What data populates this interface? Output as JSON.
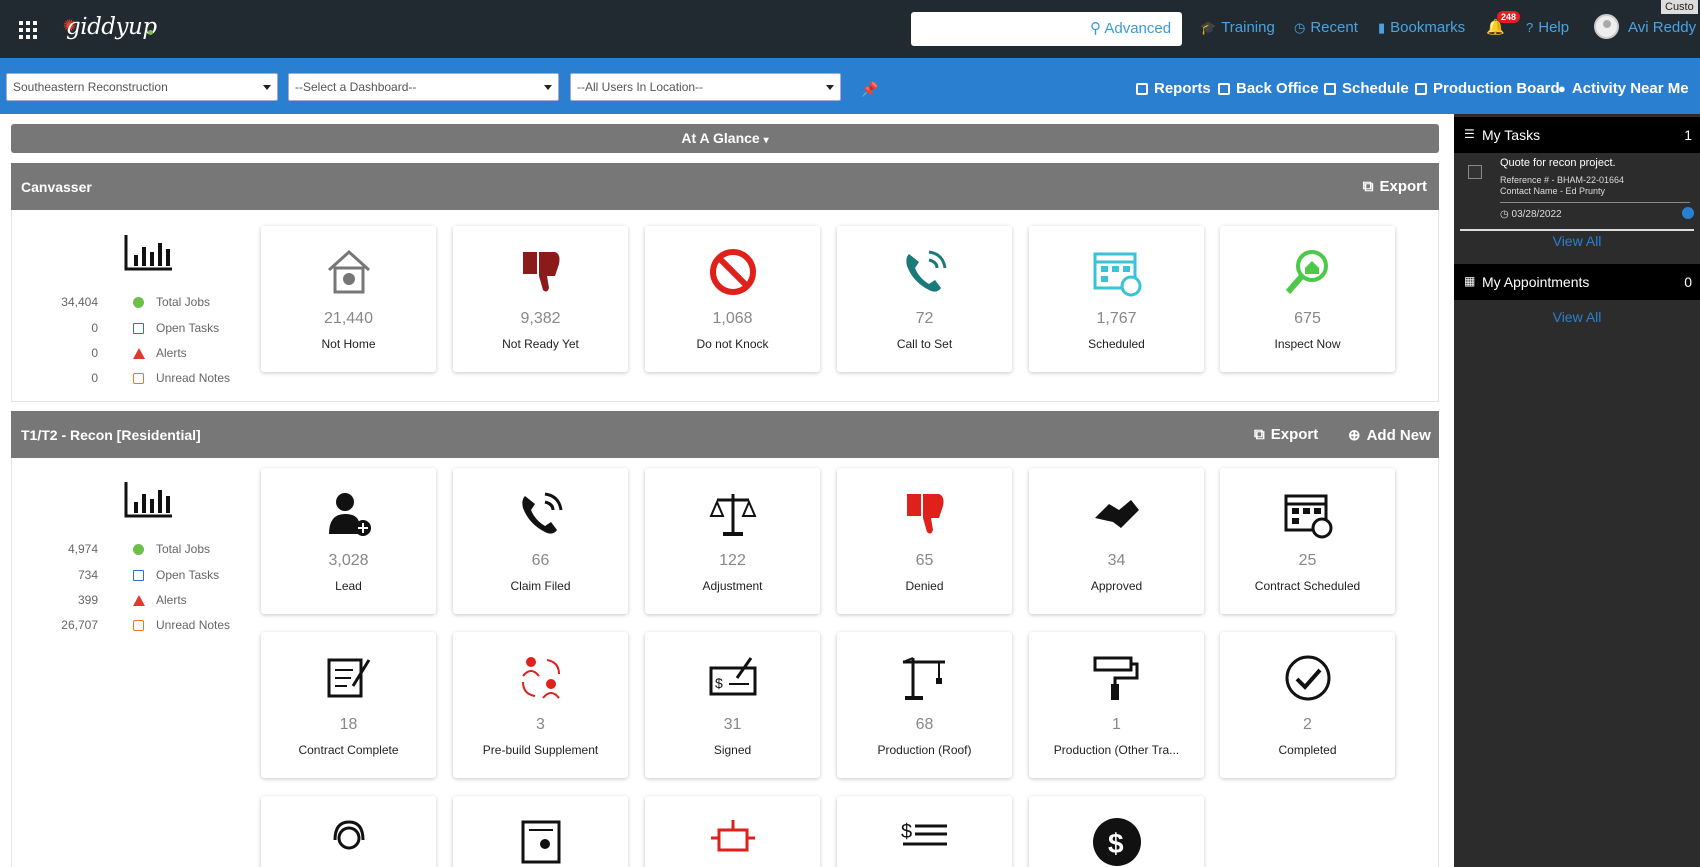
{
  "app": {
    "logo": "giddyup",
    "corner_tag": "Custo"
  },
  "topnav": {
    "search_placeholder": "",
    "advanced": "Advanced",
    "links": [
      {
        "label": "Training",
        "icon": "graduation-cap-icon"
      },
      {
        "label": "Recent",
        "icon": "clock-icon"
      },
      {
        "label": "Bookmarks",
        "icon": "bookmark-icon"
      },
      {
        "label": "Help",
        "icon": "question-icon"
      }
    ],
    "notifications": "248",
    "user": "Avi Reddy"
  },
  "filters": {
    "location": "Southeastern Reconstruction",
    "dashboard": "--Select a Dashboard--",
    "users": "--All Users In Location--",
    "links": [
      "Reports",
      "Back Office",
      "Schedule",
      "Production Board",
      "Activity Near Me"
    ]
  },
  "glance": {
    "label": "At A Glance"
  },
  "canvasser": {
    "title": "Canvasser",
    "export": "Export",
    "stats": [
      {
        "value": "34,404",
        "label": "Total Jobs"
      },
      {
        "value": "0",
        "label": "Open Tasks"
      },
      {
        "value": "0",
        "label": "Alerts"
      },
      {
        "value": "0",
        "label": "Unread Notes"
      }
    ],
    "cards": [
      {
        "value": "21,440",
        "label": "Not Home",
        "icon": "house-icon",
        "color": "#777777"
      },
      {
        "value": "9,382",
        "label": "Not Ready Yet",
        "icon": "thumbs-down-icon",
        "color": "#8b1a1a"
      },
      {
        "value": "1,068",
        "label": "Do not Knock",
        "icon": "no-entry-icon",
        "color": "#e0201a"
      },
      {
        "value": "72",
        "label": "Call to Set",
        "icon": "phone-icon",
        "color": "#1a7a7a"
      },
      {
        "value": "1,767",
        "label": "Scheduled",
        "icon": "calendar-icon",
        "color": "#39c3d6"
      },
      {
        "value": "675",
        "label": "Inspect Now",
        "icon": "magnify-house-icon",
        "color": "#4cc94a"
      }
    ]
  },
  "recon": {
    "title": "T1/T2 - Recon [Residential]",
    "export": "Export",
    "add_new": "Add New",
    "stats": [
      {
        "value": "4,974",
        "label": "Total Jobs"
      },
      {
        "value": "734",
        "label": "Open Tasks"
      },
      {
        "value": "399",
        "label": "Alerts"
      },
      {
        "value": "26,707",
        "label": "Unread Notes"
      }
    ],
    "cards": [
      {
        "value": "3,028",
        "label": "Lead",
        "icon": "add-user-icon",
        "color": "#111111"
      },
      {
        "value": "66",
        "label": "Claim Filed",
        "icon": "phone-icon",
        "color": "#111111"
      },
      {
        "value": "122",
        "label": "Adjustment",
        "icon": "scales-icon",
        "color": "#111111"
      },
      {
        "value": "65",
        "label": "Denied",
        "icon": "thumbs-down-icon",
        "color": "#e0201a"
      },
      {
        "value": "34",
        "label": "Approved",
        "icon": "handshake-icon",
        "color": "#111111"
      },
      {
        "value": "25",
        "label": "Contract Scheduled",
        "icon": "calendar-icon",
        "color": "#111111"
      },
      {
        "value": "18",
        "label": "Contract Complete",
        "icon": "contract-pen-icon",
        "color": "#111111"
      },
      {
        "value": "3",
        "label": "Pre-build Supplement",
        "icon": "people-exchange-icon",
        "color": "#e0201a"
      },
      {
        "value": "31",
        "label": "Signed",
        "icon": "check-sign-icon",
        "color": "#111111"
      },
      {
        "value": "68",
        "label": "Production (Roof)",
        "icon": "crane-icon",
        "color": "#111111"
      },
      {
        "value": "1",
        "label": "Production (Other Tra...",
        "icon": "paint-roller-icon",
        "color": "#111111"
      },
      {
        "value": "2",
        "label": "Completed",
        "icon": "check-circle-icon",
        "color": "#111111"
      }
    ],
    "partial_icons": [
      "headset-icon",
      "id-document-icon",
      "robot-icon",
      "dollar-list-icon",
      "dollar-coin-icon"
    ]
  },
  "tasks": {
    "title": "My Tasks",
    "count": "1",
    "item": {
      "title": "Quote for recon project.",
      "reference": "Reference # - BHAM-22-01664",
      "contact": "Contact Name - Ed Prunty",
      "date": "03/28/2022"
    },
    "view_all": "View All"
  },
  "appointments": {
    "title": "My Appointments",
    "count": "0",
    "view_all": "View All"
  }
}
